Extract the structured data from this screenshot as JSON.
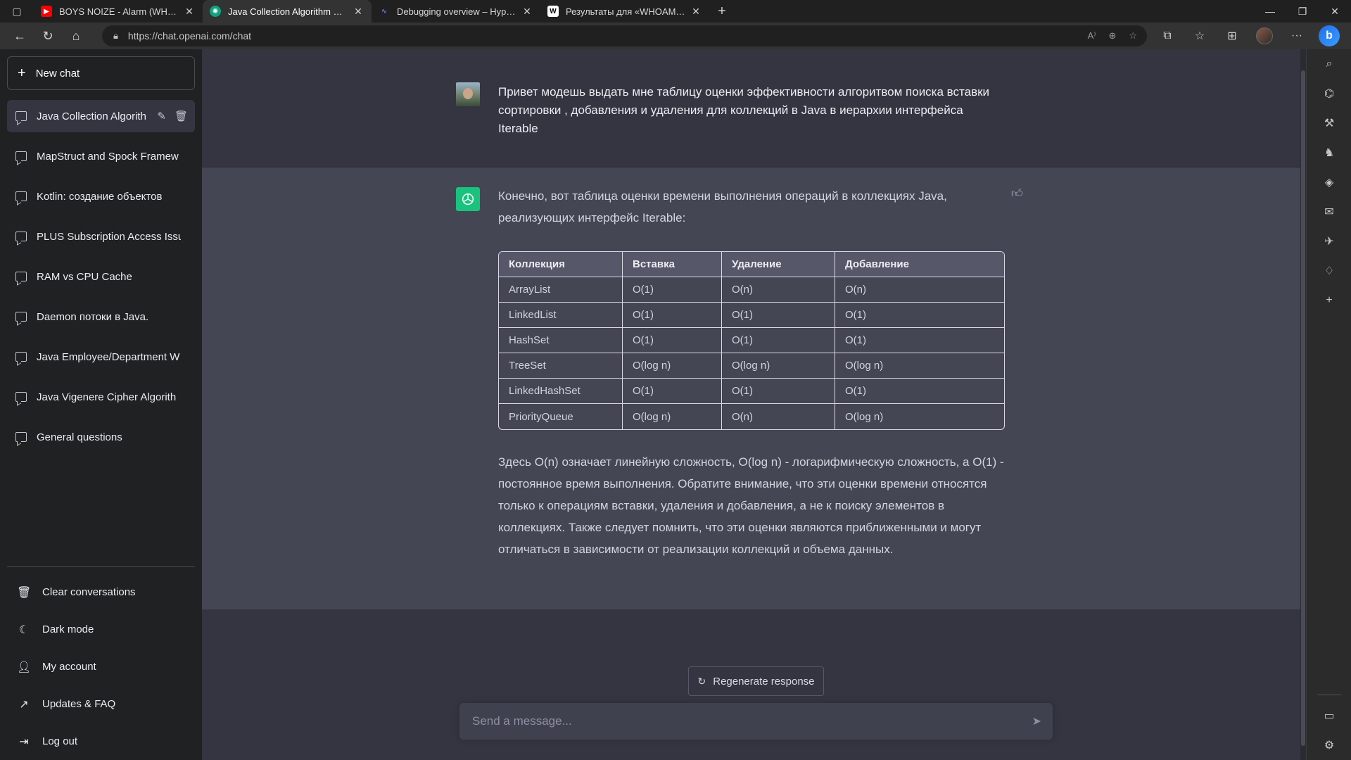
{
  "browser": {
    "tabs": [
      {
        "title": "BOYS NOIZE - Alarm (WHO AM I)",
        "favicon": "youtube-icon",
        "color": "#ff0000"
      },
      {
        "title": "Java Collection Algorithm Efficiency",
        "favicon": "openai-icon",
        "color": "#10a37f",
        "active": true
      },
      {
        "title": "Debugging overview – Hyperskill",
        "favicon": "hyperskill-icon",
        "color": "#6b7cff"
      },
      {
        "title": "Результаты для «WHOAMI» — Bing",
        "favicon": "wikipedia-icon",
        "color": "#ffffff"
      }
    ],
    "url": "https://chat.openai.com/chat"
  },
  "sidebar": {
    "new_chat": "New chat",
    "conversations": [
      "Java Collection Algorith",
      "MapStruct and Spock Framew",
      "Kotlin: создание объектов",
      "PLUS Subscription Access Issu",
      "RAM vs CPU Cache",
      "Daemon потоки в Java.",
      "Java Employee/Department W",
      "Java Vigenere Cipher Algorith",
      "General questions"
    ],
    "footer": [
      {
        "label": "Clear conversations",
        "icon": "trash-icon"
      },
      {
        "label": "Dark mode",
        "icon": "moon-icon"
      },
      {
        "label": "My account",
        "icon": "user-icon"
      },
      {
        "label": "Updates & FAQ",
        "icon": "external-link-icon"
      },
      {
        "label": "Log out",
        "icon": "logout-icon"
      }
    ]
  },
  "main": {
    "user_message": "Привет модешь выдать мне таблицу оценки эффективности алгоритвом поиска вставки сортировки , добавления и удаления для коллекций в Java в иерархии интерфейса Iterable",
    "bot_intro": "Конечно, вот таблица оценки времени выполнения операций в коллекциях Java, реализующих интерфейс Iterable:",
    "table": {
      "headers": [
        "Коллекция",
        "Вставка",
        "Удаление",
        "Добавление"
      ],
      "rows": [
        [
          "ArrayList",
          "O(1)",
          "O(n)",
          "O(n)"
        ],
        [
          "LinkedList",
          "O(1)",
          "O(1)",
          "O(1)"
        ],
        [
          "HashSet",
          "O(1)",
          "O(1)",
          "O(1)"
        ],
        [
          "TreeSet",
          "O(log n)",
          "O(log n)",
          "O(log n)"
        ],
        [
          "LinkedHashSet",
          "O(1)",
          "O(1)",
          "O(1)"
        ],
        [
          "PriorityQueue",
          "O(log n)",
          "O(n)",
          "O(log n)"
        ]
      ]
    },
    "bot_outro": "Здесь O(n) означает линейную сложность, O(log n) - логарифмическую сложность, а O(1) - постоянное время выполнения. Обратите внимание, что эти оценки времени относятся только к операциям вставки, удаления и добавления, а не к поиску элементов в коллекциях. Также следует помнить, что эти оценки являются приближенными и могут отличаться в зависимости от реализации коллекций и объема данных.",
    "regenerate": "Regenerate response",
    "input_placeholder": "Send a message..."
  },
  "colors": {
    "sidebar_bg": "#202123",
    "main_bg": "#343541",
    "bot_bg": "#444654",
    "accent": "#19c37d"
  }
}
